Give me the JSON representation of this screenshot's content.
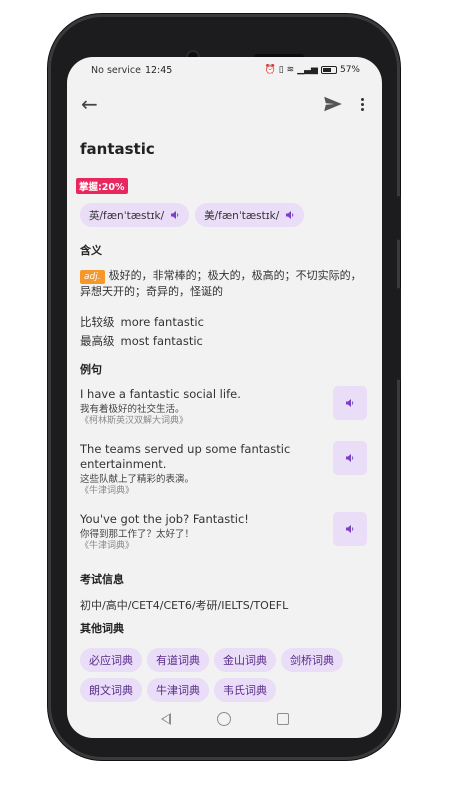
{
  "status_bar": {
    "carrier": "No service",
    "time": "12:45",
    "icons": [
      "alarm-icon",
      "vibrate-icon",
      "wifi-icon",
      "signal-icon",
      "battery-icon"
    ],
    "battery": "57%"
  },
  "toolbar": {
    "back_icon": "arrow-left-icon",
    "share_icon": "send-icon",
    "menu_icon": "more-vert-icon"
  },
  "word": "fantastic",
  "mastery": "掌握:20%",
  "phonetics": [
    {
      "label": "英/fænˈtæstɪk/",
      "icon": "speaker-icon"
    },
    {
      "label": "美/fænˈtæstɪk/",
      "icon": "speaker-icon"
    }
  ],
  "sections": {
    "meaning": "含义",
    "examples": "例句",
    "exam_info": "考试信息",
    "other_dicts": "其他词典"
  },
  "definition": {
    "pos": "adj.",
    "text": "极好的，非常棒的；极大的，极高的；不切实际的，异想天开的；奇异的，怪诞的"
  },
  "forms": [
    {
      "label": "比较级",
      "value": "more fantastic"
    },
    {
      "label": "最高级",
      "value": "most fantastic"
    }
  ],
  "examples": [
    {
      "en": "I have a fantastic social life.",
      "zh": "我有着极好的社交生活。",
      "source": "《柯林斯英汉双解大词典》"
    },
    {
      "en": "The teams served up some fantastic entertainment.",
      "zh": "这些队献上了精彩的表演。",
      "source": "《牛津词典》"
    },
    {
      "en": "You've got the job? Fantastic!",
      "zh": "你得到那工作了？太好了！",
      "source": "《牛津词典》"
    }
  ],
  "exam": "初中/高中/CET4/CET6/考研/IELTS/TOEFL",
  "dictionaries": [
    "必应词典",
    "有道词典",
    "金山词典",
    "剑桥词典",
    "朗文词典",
    "牛津词典",
    "韦氏词典"
  ],
  "colors": {
    "accent": "#7b3fc4",
    "chip_bg": "#e9ddf7",
    "mastery_bg": "#e7275e",
    "pos_bg": "#f4982c"
  }
}
